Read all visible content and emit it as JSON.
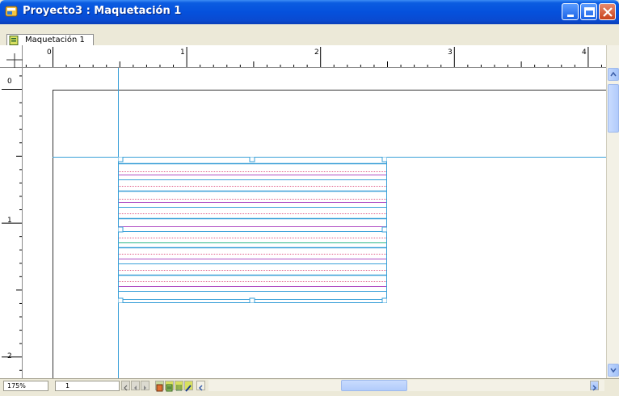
{
  "window": {
    "title": "Proyecto3 : Maquetación 1",
    "icons": {
      "app": "app-icon",
      "minimize": "minimize-icon",
      "maximize": "maximize-icon",
      "close": "close-icon"
    }
  },
  "tabs": [
    {
      "label": "Maquetación 1",
      "icon": "layout-icon"
    }
  ],
  "rulers": {
    "horizontal_labels": [
      "0",
      "1",
      "2",
      "3",
      "4"
    ],
    "vertical_labels": [
      "0",
      "1",
      "2"
    ]
  },
  "status": {
    "zoom": "175%",
    "page": "1",
    "tool_icons": [
      "first-page-icon",
      "prev-page-icon",
      "next-page-icon",
      "layout-view-icon",
      "master-view-icon",
      "guides-icon",
      "edit-icon",
      "scroll-left-icon",
      "scroll-right-icon"
    ]
  },
  "colors": {
    "title_bar": "#0551dc",
    "guide": "#3aa0d8",
    "red_line": "#e0608a",
    "magenta_line": "#b04fc4",
    "green_line": "#2db88a"
  }
}
